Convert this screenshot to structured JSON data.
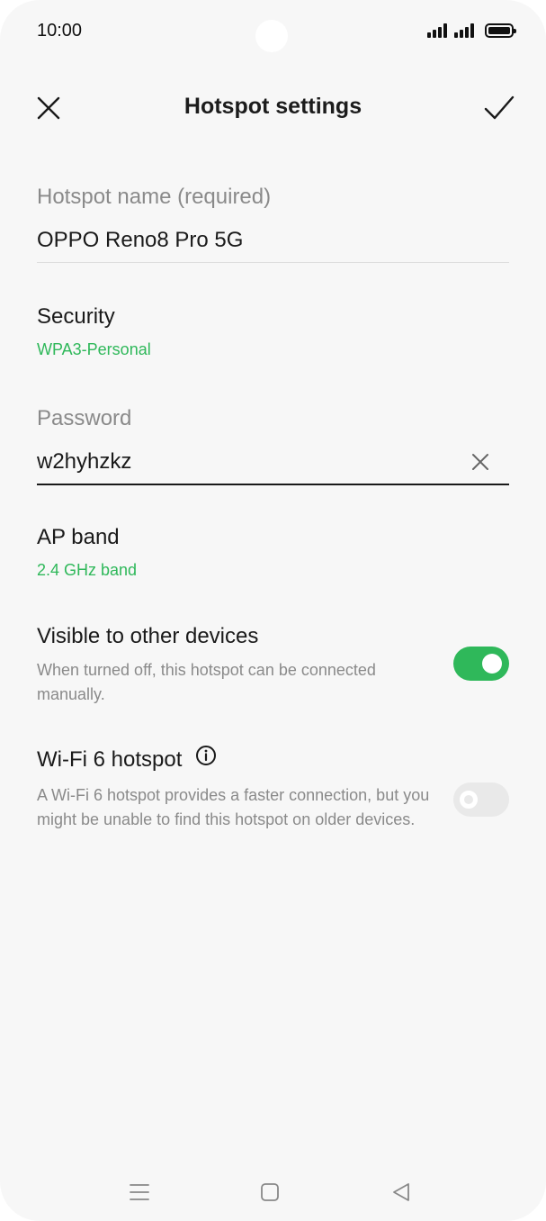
{
  "status_bar": {
    "time": "10:00",
    "icons": [
      "signal-icon",
      "signal-icon",
      "battery-icon"
    ]
  },
  "toolbar": {
    "title": "Hotspot settings",
    "close_icon": "close-icon",
    "confirm_icon": "check-icon"
  },
  "hotspot_name": {
    "label": "Hotspot name (required)",
    "value": "OPPO Reno8 Pro 5G"
  },
  "security": {
    "title": "Security",
    "value": "WPA3-Personal"
  },
  "password": {
    "label": "Password",
    "value": "w2hyhzkz",
    "clear_icon": "clear-icon"
  },
  "ap_band": {
    "title": "AP band",
    "value": "2.4 GHz band"
  },
  "visible": {
    "title": "Visible to other devices",
    "description": "When turned off, this hotspot can be connected manually.",
    "enabled": true
  },
  "wifi6": {
    "title": "Wi-Fi 6 hotspot",
    "description": "A Wi-Fi 6 hotspot provides a faster connection, but you might be unable to find this hotspot on older devices.",
    "enabled": false,
    "info_icon": "info-icon"
  },
  "nav_bar": {
    "icons": [
      "menu-icon",
      "home-icon",
      "back-icon"
    ]
  },
  "colors": {
    "accent": "#2fb85a",
    "background": "#f7f7f7",
    "toggle_off": "#e9e9e9"
  }
}
